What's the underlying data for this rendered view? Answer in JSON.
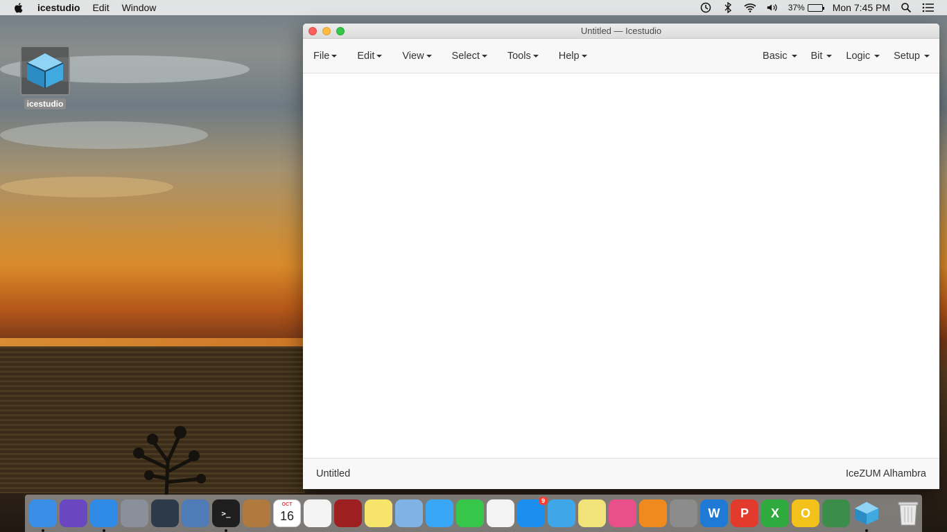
{
  "menubar": {
    "app_name": "icestudio",
    "items": [
      "Edit",
      "Window"
    ],
    "battery_pct": "37%",
    "battery_level": 0.37,
    "clock": "Mon 7:45 PM"
  },
  "desktop": {
    "icon_label": "icestudio"
  },
  "window": {
    "title": "Untitled — Icestudio",
    "menus_left": [
      "File",
      "Edit",
      "View",
      "Select",
      "Tools",
      "Help"
    ],
    "menus_right": [
      "Basic",
      "Bit",
      "Logic",
      "Setup"
    ],
    "footer_left": "Untitled",
    "footer_right": "IceZUM Alhambra"
  },
  "dock": {
    "apps": [
      {
        "name": "finder",
        "color": "#3a8ee6",
        "running": true
      },
      {
        "name": "siri",
        "color": "#6b46c1",
        "running": false
      },
      {
        "name": "safari",
        "color": "#2f8be6",
        "running": true
      },
      {
        "name": "launchpad",
        "color": "#8a9099",
        "running": false
      },
      {
        "name": "image-capture",
        "color": "#2d3a4a",
        "running": false
      },
      {
        "name": "mail-stamp",
        "color": "#4f7bb6",
        "running": false
      },
      {
        "name": "terminal",
        "color": "#1e1e1e",
        "running": true
      },
      {
        "name": "contacts",
        "color": "#b07a3e",
        "running": false
      },
      {
        "name": "calendar",
        "color": "#ffffff",
        "running": false
      },
      {
        "name": "reminders",
        "color": "#f4f4f4",
        "running": false
      },
      {
        "name": "photo-booth",
        "color": "#9e1f1f",
        "running": false
      },
      {
        "name": "notes",
        "color": "#f7e46a",
        "running": false
      },
      {
        "name": "preview",
        "color": "#7fb3e6",
        "running": false
      },
      {
        "name": "messages",
        "color": "#38a7f5",
        "running": false
      },
      {
        "name": "facetime",
        "color": "#36c74a",
        "running": false
      },
      {
        "name": "photos",
        "color": "#f3f3f3",
        "running": false
      },
      {
        "name": "app-store",
        "color": "#1c8ef0",
        "running": false
      },
      {
        "name": "game-app",
        "color": "#3fa6e8",
        "running": false
      },
      {
        "name": "stickies",
        "color": "#f2e27a",
        "running": false
      },
      {
        "name": "itunes",
        "color": "#e94f8a",
        "running": false
      },
      {
        "name": "ibooks",
        "color": "#f18a1e",
        "running": false
      },
      {
        "name": "system-preferences",
        "color": "#8c8c8c",
        "running": false
      },
      {
        "name": "wps-writer",
        "color": "#1f7ad6",
        "running": false
      },
      {
        "name": "wps-presentation",
        "color": "#e23b2e",
        "running": false
      },
      {
        "name": "wps-spreadsheet",
        "color": "#2eaa3f",
        "running": false
      },
      {
        "name": "office-o",
        "color": "#f2c21b",
        "running": false
      },
      {
        "name": "network-utility",
        "color": "#3c8c4a",
        "running": false
      },
      {
        "name": "icestudio",
        "color": "#47a9e6",
        "running": true
      }
    ],
    "calendar_month": "OCT",
    "calendar_day": "16",
    "app_store_badge": "9"
  }
}
